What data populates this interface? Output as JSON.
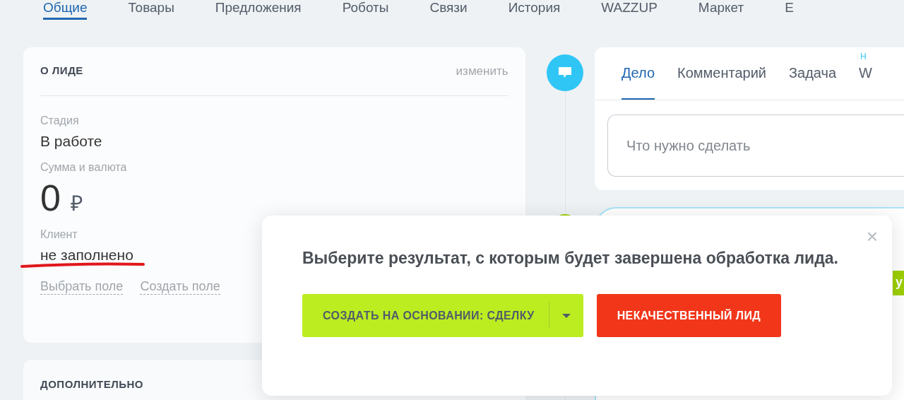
{
  "top_tabs": [
    {
      "label": "Общие",
      "selected": true
    },
    {
      "label": "Товары",
      "selected": false
    },
    {
      "label": "Предложения",
      "selected": false
    },
    {
      "label": "Роботы",
      "selected": false
    },
    {
      "label": "Связи",
      "selected": false
    },
    {
      "label": "История",
      "selected": false
    },
    {
      "label": "WAZZUP",
      "selected": false
    },
    {
      "label": "Маркет",
      "selected": false
    },
    {
      "label": "Е",
      "selected": false
    }
  ],
  "lead_card": {
    "title": "О ЛИДЕ",
    "edit_link": "изменить",
    "fields": [
      {
        "label": "Стадия",
        "value": "В работе",
        "kind": "text"
      },
      {
        "label": "Сумма и валюта",
        "value": "0",
        "currency": "₽",
        "kind": "money"
      },
      {
        "label": "Клиент",
        "value": "не заполнено",
        "kind": "text",
        "underlined": true
      }
    ],
    "links": [
      "Выбрать поле",
      "Создать поле"
    ]
  },
  "extra_card": {
    "title": "ДОПОЛНИТЕЛЬНО"
  },
  "activity": {
    "tabs": [
      {
        "label": "Дело",
        "selected": true
      },
      {
        "label": "Комментарий",
        "selected": false
      },
      {
        "label": "Задача",
        "selected": false
      },
      {
        "label": "W",
        "selected": false,
        "badge": "Н"
      }
    ],
    "input": {
      "placeholder": "Что нужно сделать"
    }
  },
  "background_card": {
    "button": "у"
  },
  "dialog": {
    "message": "Выберите результат, с которым будет завершена обработка лида.",
    "close": "×",
    "buttons": [
      {
        "label": "СОЗДАТЬ НА ОСНОВАНИИ: СДЕЛКУ",
        "kind": "split"
      },
      {
        "label": "НЕКАЧЕСТВЕННЫЙ ЛИД",
        "kind": "danger"
      }
    ]
  }
}
